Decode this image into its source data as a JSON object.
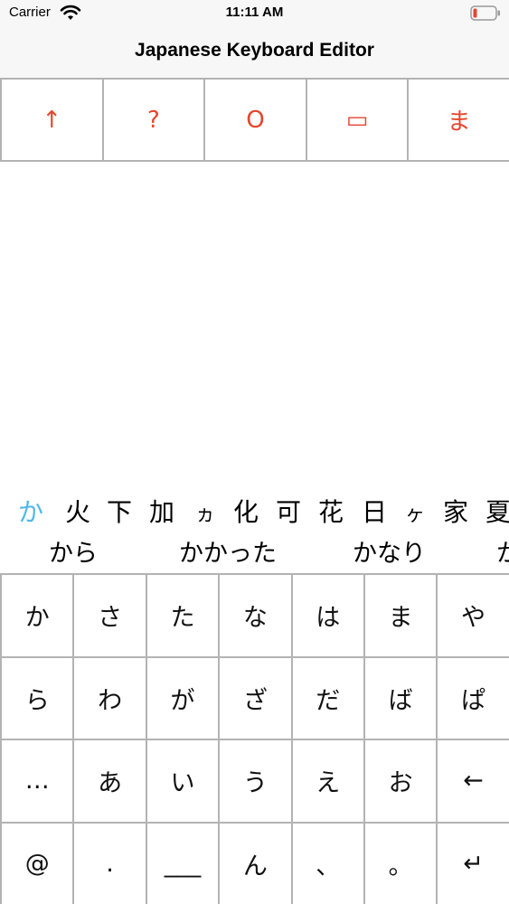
{
  "status_bar": {
    "carrier": "Carrier",
    "time": "11:11 AM",
    "wifi_icon": "wifi-icon",
    "battery_icon": "battery-low-icon",
    "battery_color": "#e5452f"
  },
  "nav": {
    "title": "Japanese Keyboard Editor"
  },
  "top_keys": [
    "↑",
    "?",
    "O",
    "▭",
    "ま"
  ],
  "accent_color": "#e5452f",
  "candidates": {
    "row1": [
      "か",
      "火",
      "下",
      "加",
      "ヵ",
      "化",
      "可",
      "花",
      "日",
      "ヶ",
      "家",
      "夏"
    ],
    "row1_selected_index": 0,
    "row1_selected_color": "#4fb8e8",
    "row2": [
      "から",
      "かかった",
      "かなり",
      "か"
    ]
  },
  "keyboard": {
    "rows": [
      [
        "か",
        "さ",
        "た",
        "な",
        "は",
        "ま",
        "や"
      ],
      [
        "ら",
        "わ",
        "が",
        "ざ",
        "だ",
        "ば",
        "ぱ"
      ],
      [
        "…",
        "あ",
        "い",
        "う",
        "え",
        "お",
        "←"
      ],
      [
        "@",
        ".",
        "___",
        "ん",
        "、",
        "。",
        "↵"
      ]
    ]
  }
}
